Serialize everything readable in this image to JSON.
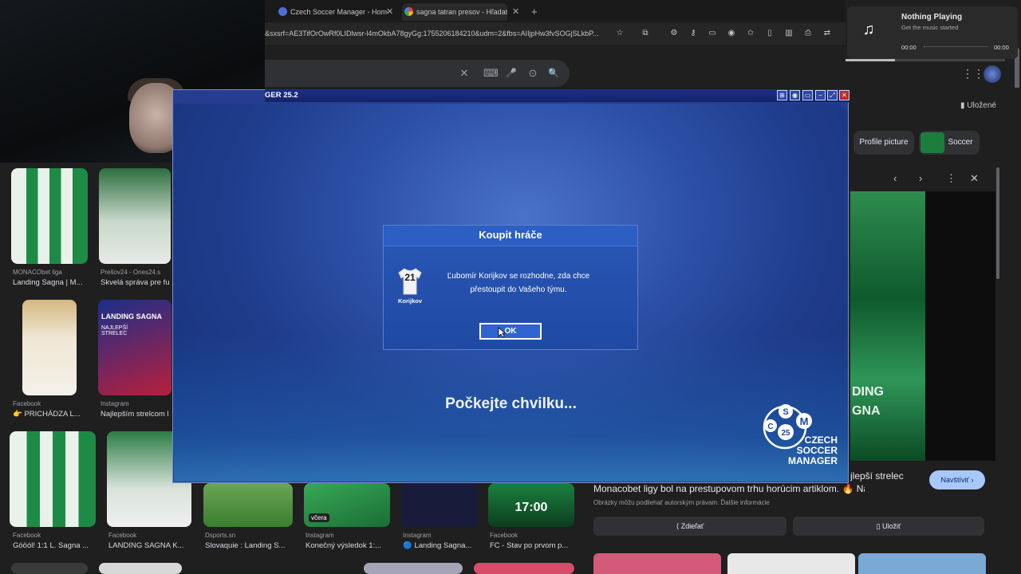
{
  "browser": {
    "tabs": [
      {
        "title": "Czech Soccer Manager - Home",
        "active": false
      },
      {
        "title": "sagna tatran presov - Hľadať G",
        "active": true
      }
    ],
    "new_tab": "+",
    "url": "&sxsrf=AE3TifOrOwRf0LIDlwsr-l4mOkbA78gyGg:1755206184210&udm=2&fbs=AIIjpHw3fvSOGjSLkbP..."
  },
  "search": {
    "clear_icon": "✕",
    "keyboard_icon": "⌨",
    "mic_icon": "🎤",
    "lens_icon": "⊙",
    "search_icon": "🔍"
  },
  "music": {
    "title": "Nothing Playing",
    "subtitle": "Get the music started",
    "time_start": "00:00",
    "time_end": "00:00"
  },
  "game": {
    "title": "GER 25.2",
    "wait_text": "Počkejte chvilku...",
    "dialog": {
      "title": "Koupit hráče",
      "shirt_number": "21",
      "player_name": "Korijkov",
      "message_line1": "Ľubomír Korijkov se rozhodne, zda chce",
      "message_line2": "přestoupit do Vašeho týmu.",
      "ok_label": "OK"
    },
    "logo": {
      "letters": [
        "C",
        "S",
        "M",
        "25"
      ],
      "line1": "CZECH",
      "line2": "SOCCER",
      "line3": "MANAGER"
    }
  },
  "right_panel": {
    "saved": "Uložené",
    "chips": [
      "Profile picture",
      "Soccer"
    ],
    "preview_overlay": "DING\nGNA",
    "title": "Monacobet ligy bol na prestupovom trhu horúcim artiklom. 🔥 Naprie...",
    "title_top": "jlepší strelec",
    "visit": "Navštíviť ›",
    "note": "Obrázky môžu podliehať autorským právam.  Ďalšie informácie",
    "share": "Zdieľať",
    "save": "Uložiť"
  },
  "results": [
    {
      "source": "MONACObet liga",
      "title": "Landing Sagna | M..."
    },
    {
      "source": "Prešov24 - Ones24.s",
      "title": "Skvelá správa pre fu"
    },
    {
      "source": "Facebook",
      "title": "👉 PRICHÁDZA L..."
    },
    {
      "source": "Instagram",
      "title": "Najlepším strelcom l"
    },
    {
      "source": "Facebook",
      "title": "Gööól! 1:1 L. Sagna ..."
    },
    {
      "source": "Facebook",
      "title": "LANDING SAGNA K..."
    },
    {
      "source": "Dsports.sn",
      "title": "Slovaquie : Landing S..."
    },
    {
      "source": "Instagram",
      "title": "Konečný výsledok 1:..."
    },
    {
      "source": "Instagram",
      "title": "🔵 Landing Sagna..."
    },
    {
      "source": "Facebook",
      "title": "FC - Stav po prvom p..."
    }
  ],
  "result_thumb_text": {
    "landing_sagna": "LANDING SAGNA",
    "sagna_tag": "NAJLEPŠÍ STRELEC",
    "vcera": "včera",
    "score_time": "17:00"
  },
  "colors": {
    "game_blue": "#263c8f",
    "dialog_blue": "#2a56b6",
    "accent_green": "#1d8b45",
    "visit_btn": "#a8c7fa"
  }
}
